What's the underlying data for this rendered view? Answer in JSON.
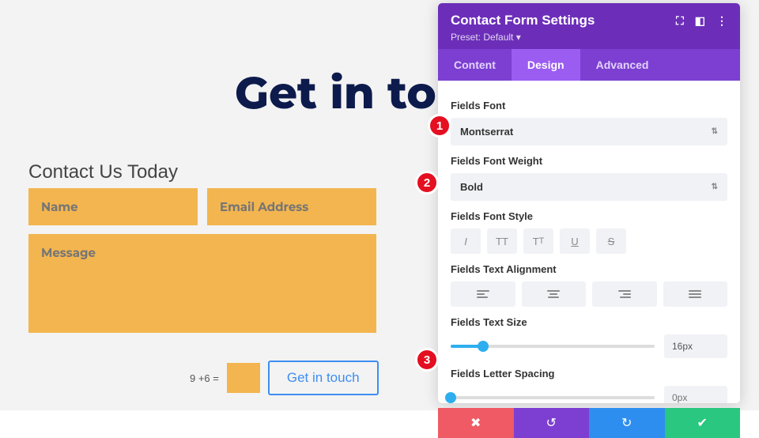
{
  "page": {
    "heading": "Get in touch",
    "contact_label": "Contact Us Today",
    "fields": {
      "name_ph": "Name",
      "email_ph": "Email Address",
      "msg_ph": "Message"
    },
    "captcha_q": "9 +6 =",
    "submit_label": "Get in touch"
  },
  "panel": {
    "title": "Contact Form Settings",
    "preset": "Preset: Default ▾",
    "tabs": {
      "content": "Content",
      "design": "Design",
      "advanced": "Advanced"
    },
    "fields_font": {
      "label": "Fields Font",
      "value": "Montserrat"
    },
    "fields_weight": {
      "label": "Fields Font Weight",
      "value": "Bold"
    },
    "fields_style": {
      "label": "Fields Font Style"
    },
    "fields_align": {
      "label": "Fields Text Alignment"
    },
    "fields_size": {
      "label": "Fields Text Size",
      "value": "16px",
      "pct": 16
    },
    "fields_spacing": {
      "label": "Fields Letter Spacing",
      "value": "0px",
      "pct": 0
    }
  },
  "badges": {
    "b1": "1",
    "b2": "2",
    "b3": "3"
  }
}
